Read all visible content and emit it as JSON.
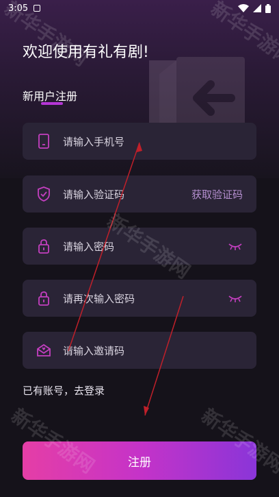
{
  "status_bar": {
    "time": "3:05"
  },
  "header": {
    "welcome": "欢迎使用有礼有剧!",
    "register_title": "新用户注册"
  },
  "form": {
    "phone": {
      "placeholder": "请输入手机号",
      "icon": "phone-icon"
    },
    "code": {
      "placeholder": "请输入验证码",
      "icon": "shield-check-icon",
      "action": "获取验证码"
    },
    "password": {
      "placeholder": "请输入密码",
      "icon": "lock-icon"
    },
    "password_confirm": {
      "placeholder": "请再次输入密码",
      "icon": "lock-icon"
    },
    "invite": {
      "placeholder": "请输入邀请码",
      "icon": "envelope-heart-icon"
    }
  },
  "login_link": "已有账号，去登录",
  "submit_label": "注册",
  "watermark": "新华手游网",
  "colors": {
    "accent": "#b536d6",
    "field_bg": "#2a2436",
    "icon": "#c43fc0",
    "button_start": "#e53ea6",
    "button_end": "#8a35d8"
  }
}
